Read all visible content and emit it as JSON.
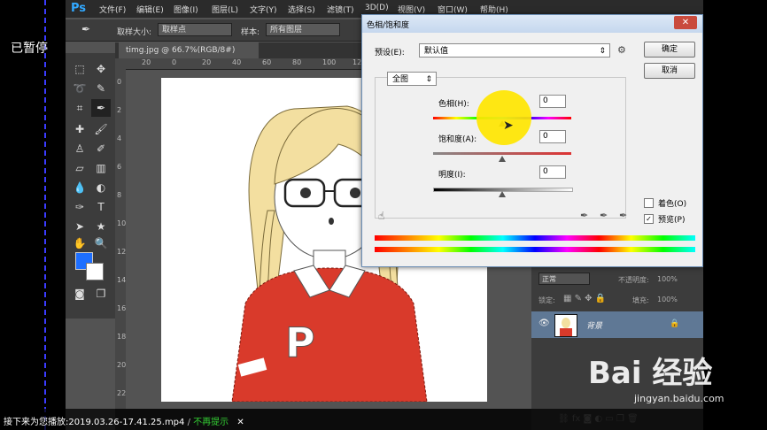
{
  "player": {
    "paused_label": "已暂停",
    "bottom_prefix": "接下来为您播放:2019.03.26-17.41.25.mp4",
    "bottom_link": "不再提示",
    "close_glyph": "✕"
  },
  "photoshop": {
    "logo": "Ps",
    "menu": [
      "文件(F)",
      "编辑(E)",
      "图像(I)",
      "图层(L)",
      "文字(Y)",
      "选择(S)",
      "滤镜(T)",
      "3D(D)",
      "视图(V)",
      "窗口(W)",
      "帮助(H)"
    ],
    "options_bar": {
      "sample_size_label": "取样大小:",
      "sample_size_value": "取样点",
      "sample_label": "样本:",
      "sample_value": "所有图层"
    },
    "document_tab": "timg.jpg @ 66.7%(RGB/8#)",
    "ruler_top": [
      "20",
      "0",
      "20",
      "40",
      "60",
      "80",
      "100",
      "120",
      "140",
      "160"
    ],
    "ruler_left": [
      "0",
      "2",
      "4",
      "6",
      "8",
      "10",
      "12",
      "14",
      "16",
      "18",
      "20",
      "22"
    ],
    "colors": {
      "foreground": "#1e6fff",
      "background": "#ffffff"
    }
  },
  "dialog": {
    "title": "色相/饱和度",
    "preset_label": "预设(E):",
    "preset_value": "默认值",
    "ok_label": "确定",
    "cancel_label": "取消",
    "channel_value": "全图",
    "hue_label": "色相(H):",
    "hue_value": "0",
    "saturation_label": "饱和度(A):",
    "saturation_value": "0",
    "lightness_label": "明度(I):",
    "lightness_value": "0",
    "colorize_label": "着色(O)",
    "colorize_checked": false,
    "preview_label": "预览(P)",
    "preview_checked": true
  },
  "layers": {
    "blend_mode": "正常",
    "opacity_label": "不透明度:",
    "opacity_value": "100%",
    "lock_label": "锁定:",
    "fill_label": "填充:",
    "fill_value": "100%",
    "layer_name": "背景"
  },
  "watermark": {
    "logo_text": "Bai 经验",
    "url": "jingyan.baidu.com"
  }
}
